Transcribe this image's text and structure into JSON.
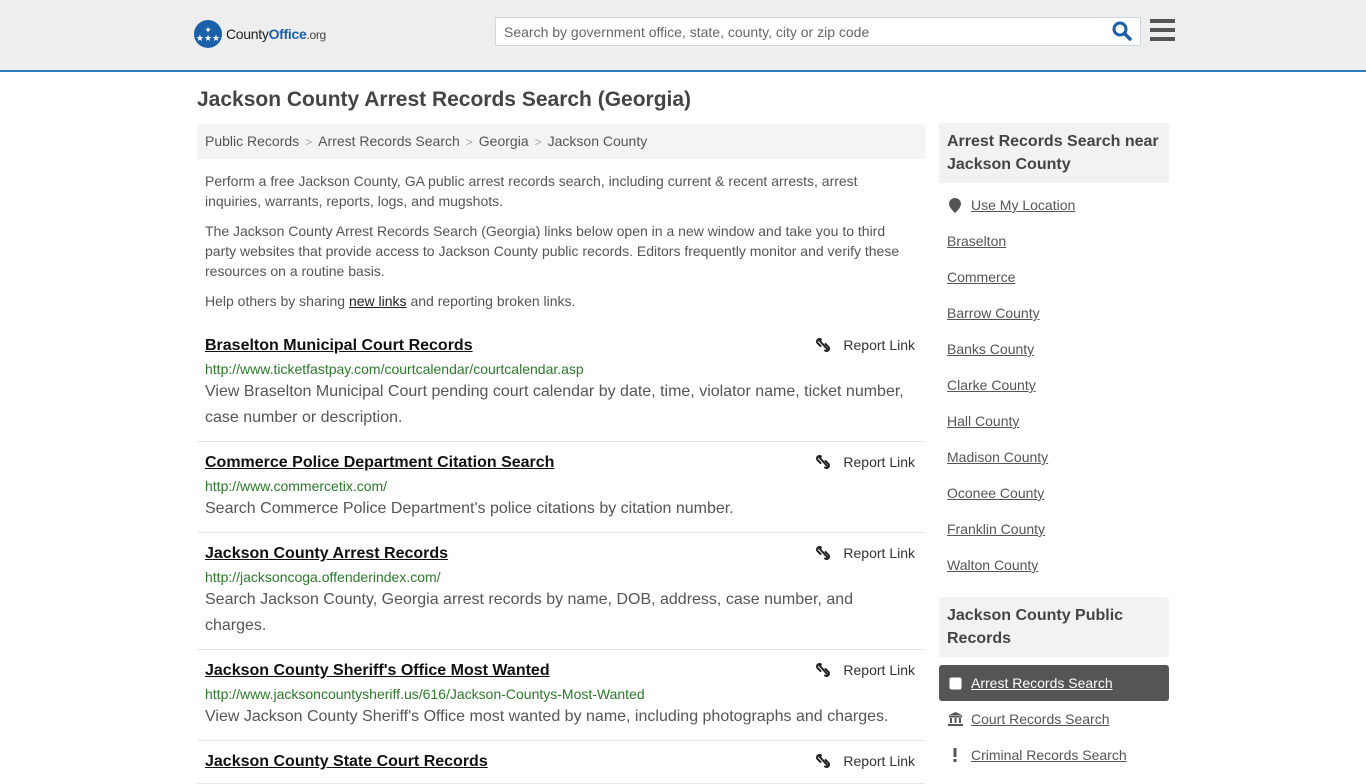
{
  "header": {
    "logo": {
      "county": "County",
      "office": "Office",
      "org": ".org"
    },
    "search_placeholder": "Search by government office, state, county, city or zip code"
  },
  "page_title": "Jackson County Arrest Records Search (Georgia)",
  "breadcrumb": [
    "Public Records",
    "Arrest Records Search",
    "Georgia",
    "Jackson County"
  ],
  "intro": {
    "p1": "Perform a free Jackson County, GA public arrest records search, including current & recent arrests, arrest inquiries, warrants, reports, logs, and mugshots.",
    "p2": "The Jackson County Arrest Records Search (Georgia) links below open in a new window and take you to third party websites that provide access to Jackson County public records. Editors frequently monitor and verify these resources on a routine basis.",
    "p3_before": "Help others by sharing ",
    "p3_link": "new links",
    "p3_after": " and reporting broken links."
  },
  "report_label": "Report Link",
  "listings": [
    {
      "title": "Braselton Municipal Court Records",
      "url": "http://www.ticketfastpay.com/courtcalendar/courtcalendar.asp",
      "desc": "View Braselton Municipal Court pending court calendar by date, time, violator name, ticket number, case number or description."
    },
    {
      "title": "Commerce Police Department Citation Search",
      "url": "http://www.commercetix.com/",
      "desc": "Search Commerce Police Department's police citations by citation number."
    },
    {
      "title": "Jackson County Arrest Records",
      "url": "http://jacksoncoga.offenderindex.com/",
      "desc": "Search Jackson County, Georgia arrest records by name, DOB, address, case number, and charges."
    },
    {
      "title": "Jackson County Sheriff's Office Most Wanted",
      "url": "http://www.jacksoncountysheriff.us/616/Jackson-Countys-Most-Wanted",
      "desc": "View Jackson County Sheriff's Office most wanted by name, including photographs and charges."
    },
    {
      "title": "Jackson County State Court Records",
      "url": "",
      "desc": ""
    }
  ],
  "sidebar": {
    "nearby_title": "Arrest Records Search near Jackson County",
    "use_location": "Use My Location",
    "nearby": [
      "Braselton",
      "Commerce",
      "Barrow County",
      "Banks County",
      "Clarke County",
      "Hall County",
      "Madison County",
      "Oconee County",
      "Franklin County",
      "Walton County"
    ],
    "public_title": "Jackson County Public Records",
    "public_records": [
      {
        "label": "Arrest Records Search",
        "icon": "square-icon",
        "active": true
      },
      {
        "label": "Court Records Search",
        "icon": "courthouse-icon",
        "active": false
      },
      {
        "label": "Criminal Records Search",
        "icon": "exclamation-icon",
        "active": false
      }
    ]
  },
  "colors": {
    "accent": "#2f7ab8",
    "brand": "#1b5fa8",
    "url_green": "#2a7a2a"
  }
}
